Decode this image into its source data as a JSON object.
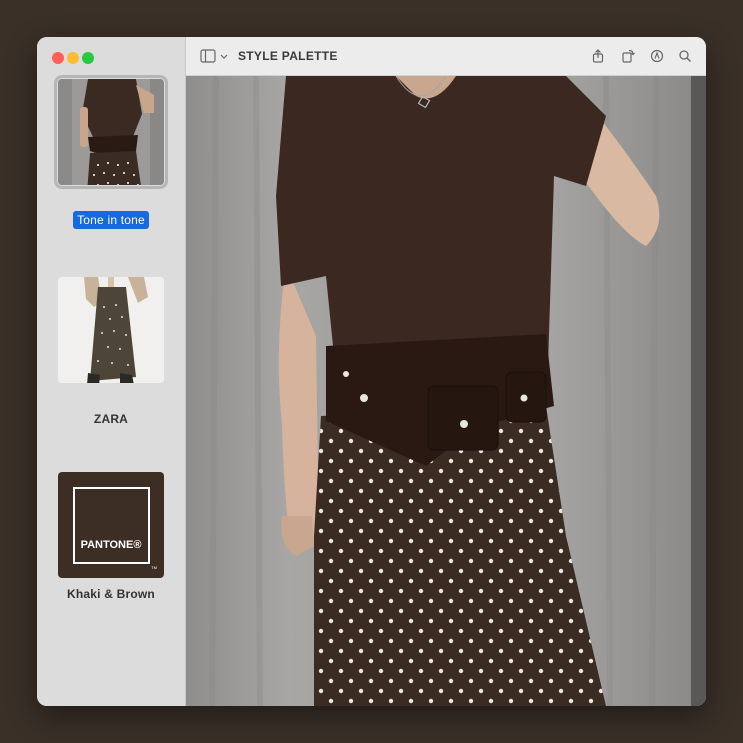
{
  "window": {
    "title": "STYLE PALETTE"
  },
  "sidebar": {
    "items": [
      {
        "label": "Tone in tone",
        "selected": true
      },
      {
        "label": "ZARA",
        "selected": false
      },
      {
        "label": "Khaki & Brown",
        "selected": false
      }
    ],
    "swatch_text": "PANTONE®",
    "swatch_tm": "TM"
  },
  "colors": {
    "accent": "#1769e0",
    "brown": "#3e2b22",
    "khaki_brown": "#3d2e25"
  },
  "toolbar": {
    "icons": [
      "sidebar-toggle-icon",
      "chevron-down-icon",
      "share-icon",
      "rotate-icon",
      "markup-icon",
      "search-icon"
    ]
  }
}
